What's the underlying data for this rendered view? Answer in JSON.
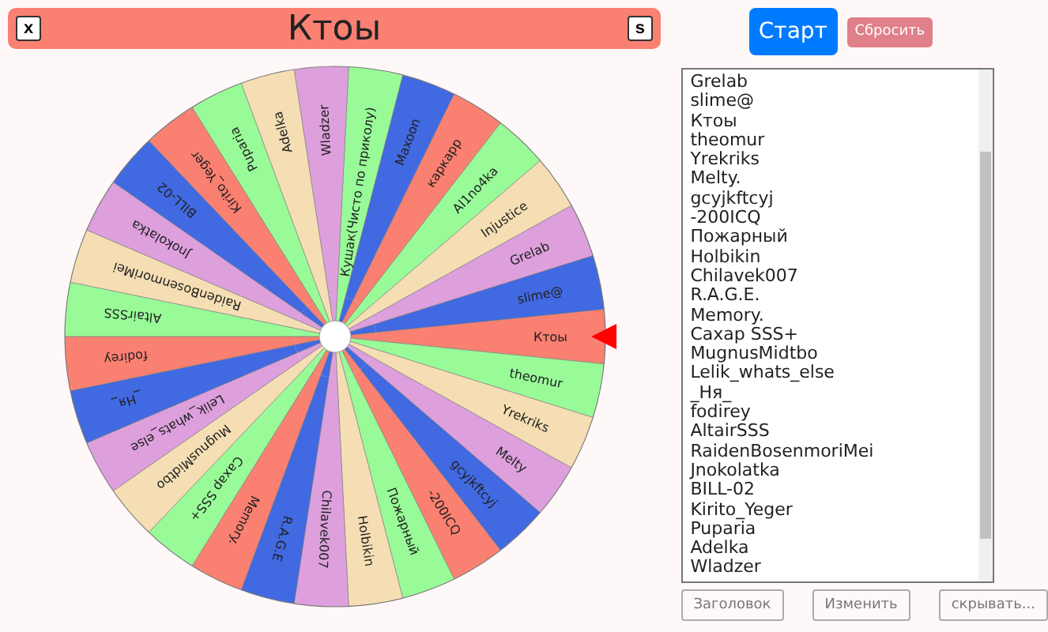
{
  "header": {
    "title": "Ктоы",
    "close_key": "x",
    "save_key": "s"
  },
  "actions": {
    "start": "Старт",
    "reset": "Сбросить"
  },
  "wheel": {
    "segments": [
      {
        "label": "Ктоы",
        "color": "#fa8072"
      },
      {
        "label": "theomur",
        "color": "#98fb98"
      },
      {
        "label": "Yrekriks",
        "color": "#f5deb3"
      },
      {
        "label": "Melty",
        "color": "#dda0dd"
      },
      {
        "label": "gcyjkftcyj",
        "color": "#4169e1"
      },
      {
        "label": "-200ICQ",
        "color": "#fa8072"
      },
      {
        "label": "Пожарный",
        "color": "#98fb98"
      },
      {
        "label": "Holbikin",
        "color": "#f5deb3"
      },
      {
        "label": "Chilavek007",
        "color": "#dda0dd"
      },
      {
        "label": "R.A.G.E",
        "color": "#4169e1"
      },
      {
        "label": "Memory.",
        "color": "#fa8072"
      },
      {
        "label": "Сахар SSS+",
        "color": "#98fb98"
      },
      {
        "label": "MugnusMidtbo",
        "color": "#f5deb3"
      },
      {
        "label": "Lelik_whats_else",
        "color": "#dda0dd"
      },
      {
        "label": "_Ня_",
        "color": "#4169e1"
      },
      {
        "label": "fodirey",
        "color": "#fa8072"
      },
      {
        "label": "AltairSSS",
        "color": "#98fb98"
      },
      {
        "label": "RaidenBosenmoriMei",
        "color": "#f5deb3"
      },
      {
        "label": "Jnokolatka",
        "color": "#dda0dd"
      },
      {
        "label": "BILL-02",
        "color": "#4169e1"
      },
      {
        "label": "Kirito_Yeger",
        "color": "#fa8072"
      },
      {
        "label": "Puparia",
        "color": "#98fb98"
      },
      {
        "label": "Adelka",
        "color": "#f5deb3"
      },
      {
        "label": "Wladzer",
        "color": "#dda0dd"
      },
      {
        "label": "Кушак(Чисто по приколу)",
        "color": "#98fb98"
      },
      {
        "label": "Maxoon",
        "color": "#4169e1"
      },
      {
        "label": "каркарр",
        "color": "#fa8072"
      },
      {
        "label": "Al1no4ka",
        "color": "#98fb98"
      },
      {
        "label": "Injustice",
        "color": "#f5deb3"
      },
      {
        "label": "Grelab",
        "color": "#dda0dd"
      },
      {
        "label": "slime@",
        "color": "#4169e1"
      }
    ]
  },
  "list": {
    "items": [
      "Grelab",
      "slime@",
      "Ктоы",
      "theomur",
      "Yrekriks",
      "Melty.",
      "gcyjkftcyj",
      "-200ICQ",
      "Пожарный",
      "Holbikin",
      "Chilavek007",
      "R.A.G.E.",
      "Memory.",
      "Сахар SSS+",
      "MugnusMidtbo",
      "Lelik_whats_else",
      "_Ня_",
      "fodirey",
      "AltairSSS",
      "RaidenBosenmoriMei",
      "Jnokolatka",
      "BILL-02",
      "Kirito_Yeger",
      "Puparia",
      "Adelka",
      "Wladzer"
    ]
  },
  "list_buttons": [
    "Заголовок",
    "Изменить",
    "скрывать..."
  ]
}
